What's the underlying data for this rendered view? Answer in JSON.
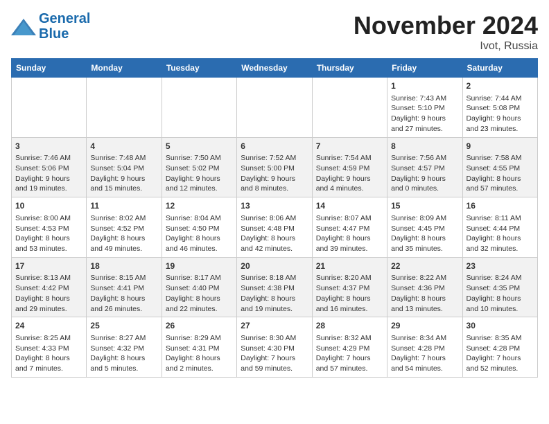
{
  "header": {
    "logo_line1": "General",
    "logo_line2": "Blue",
    "month": "November 2024",
    "location": "Ivot, Russia"
  },
  "weekdays": [
    "Sunday",
    "Monday",
    "Tuesday",
    "Wednesday",
    "Thursday",
    "Friday",
    "Saturday"
  ],
  "weeks": [
    [
      {
        "day": "",
        "info": ""
      },
      {
        "day": "",
        "info": ""
      },
      {
        "day": "",
        "info": ""
      },
      {
        "day": "",
        "info": ""
      },
      {
        "day": "",
        "info": ""
      },
      {
        "day": "1",
        "info": "Sunrise: 7:43 AM\nSunset: 5:10 PM\nDaylight: 9 hours\nand 27 minutes."
      },
      {
        "day": "2",
        "info": "Sunrise: 7:44 AM\nSunset: 5:08 PM\nDaylight: 9 hours\nand 23 minutes."
      }
    ],
    [
      {
        "day": "3",
        "info": "Sunrise: 7:46 AM\nSunset: 5:06 PM\nDaylight: 9 hours\nand 19 minutes."
      },
      {
        "day": "4",
        "info": "Sunrise: 7:48 AM\nSunset: 5:04 PM\nDaylight: 9 hours\nand 15 minutes."
      },
      {
        "day": "5",
        "info": "Sunrise: 7:50 AM\nSunset: 5:02 PM\nDaylight: 9 hours\nand 12 minutes."
      },
      {
        "day": "6",
        "info": "Sunrise: 7:52 AM\nSunset: 5:00 PM\nDaylight: 9 hours\nand 8 minutes."
      },
      {
        "day": "7",
        "info": "Sunrise: 7:54 AM\nSunset: 4:59 PM\nDaylight: 9 hours\nand 4 minutes."
      },
      {
        "day": "8",
        "info": "Sunrise: 7:56 AM\nSunset: 4:57 PM\nDaylight: 9 hours\nand 0 minutes."
      },
      {
        "day": "9",
        "info": "Sunrise: 7:58 AM\nSunset: 4:55 PM\nDaylight: 8 hours\nand 57 minutes."
      }
    ],
    [
      {
        "day": "10",
        "info": "Sunrise: 8:00 AM\nSunset: 4:53 PM\nDaylight: 8 hours\nand 53 minutes."
      },
      {
        "day": "11",
        "info": "Sunrise: 8:02 AM\nSunset: 4:52 PM\nDaylight: 8 hours\nand 49 minutes."
      },
      {
        "day": "12",
        "info": "Sunrise: 8:04 AM\nSunset: 4:50 PM\nDaylight: 8 hours\nand 46 minutes."
      },
      {
        "day": "13",
        "info": "Sunrise: 8:06 AM\nSunset: 4:48 PM\nDaylight: 8 hours\nand 42 minutes."
      },
      {
        "day": "14",
        "info": "Sunrise: 8:07 AM\nSunset: 4:47 PM\nDaylight: 8 hours\nand 39 minutes."
      },
      {
        "day": "15",
        "info": "Sunrise: 8:09 AM\nSunset: 4:45 PM\nDaylight: 8 hours\nand 35 minutes."
      },
      {
        "day": "16",
        "info": "Sunrise: 8:11 AM\nSunset: 4:44 PM\nDaylight: 8 hours\nand 32 minutes."
      }
    ],
    [
      {
        "day": "17",
        "info": "Sunrise: 8:13 AM\nSunset: 4:42 PM\nDaylight: 8 hours\nand 29 minutes."
      },
      {
        "day": "18",
        "info": "Sunrise: 8:15 AM\nSunset: 4:41 PM\nDaylight: 8 hours\nand 26 minutes."
      },
      {
        "day": "19",
        "info": "Sunrise: 8:17 AM\nSunset: 4:40 PM\nDaylight: 8 hours\nand 22 minutes."
      },
      {
        "day": "20",
        "info": "Sunrise: 8:18 AM\nSunset: 4:38 PM\nDaylight: 8 hours\nand 19 minutes."
      },
      {
        "day": "21",
        "info": "Sunrise: 8:20 AM\nSunset: 4:37 PM\nDaylight: 8 hours\nand 16 minutes."
      },
      {
        "day": "22",
        "info": "Sunrise: 8:22 AM\nSunset: 4:36 PM\nDaylight: 8 hours\nand 13 minutes."
      },
      {
        "day": "23",
        "info": "Sunrise: 8:24 AM\nSunset: 4:35 PM\nDaylight: 8 hours\nand 10 minutes."
      }
    ],
    [
      {
        "day": "24",
        "info": "Sunrise: 8:25 AM\nSunset: 4:33 PM\nDaylight: 8 hours\nand 7 minutes."
      },
      {
        "day": "25",
        "info": "Sunrise: 8:27 AM\nSunset: 4:32 PM\nDaylight: 8 hours\nand 5 minutes."
      },
      {
        "day": "26",
        "info": "Sunrise: 8:29 AM\nSunset: 4:31 PM\nDaylight: 8 hours\nand 2 minutes."
      },
      {
        "day": "27",
        "info": "Sunrise: 8:30 AM\nSunset: 4:30 PM\nDaylight: 7 hours\nand 59 minutes."
      },
      {
        "day": "28",
        "info": "Sunrise: 8:32 AM\nSunset: 4:29 PM\nDaylight: 7 hours\nand 57 minutes."
      },
      {
        "day": "29",
        "info": "Sunrise: 8:34 AM\nSunset: 4:28 PM\nDaylight: 7 hours\nand 54 minutes."
      },
      {
        "day": "30",
        "info": "Sunrise: 8:35 AM\nSunset: 4:28 PM\nDaylight: 7 hours\nand 52 minutes."
      }
    ]
  ]
}
